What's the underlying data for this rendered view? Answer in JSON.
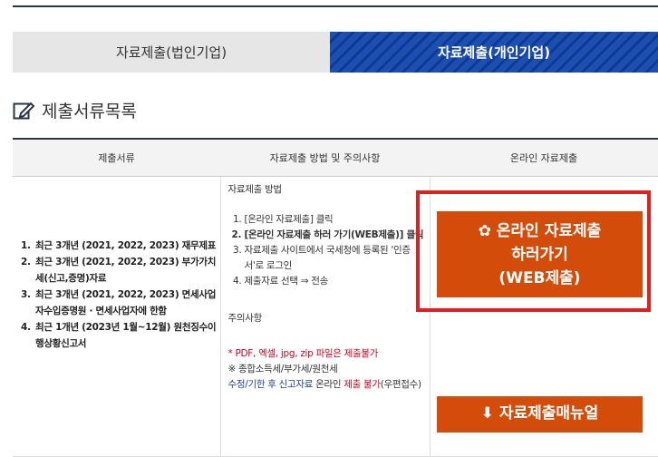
{
  "tabs": {
    "corporate": "자료제출(법인기업)",
    "individual": "자료제출(개인기업)"
  },
  "section": {
    "title": "제출서류목록"
  },
  "table": {
    "headers": [
      "제출서류",
      "자료제출 방법 및 주의사항",
      "온라인 자료제출"
    ],
    "documents": [
      "최근 3개년 (2021, 2022, 2023) 재무제표",
      "최근 3개년 (2021, 2022, 2023) 부가가치세(신고,증명)자료",
      "최근 3개년 (2021, 2022, 2023) 면세사업자수입증명원 · 면세사업자에 한함",
      "최근 1개년 (2023년 1월~12월) 원천징수이행상황신고서"
    ],
    "method": {
      "heading": "자료제출 방법",
      "steps": [
        "[온라인 자료제출] 클릭",
        "[온라인 자료제출 하러 가기(WEB제출)] 클릭",
        "자료제출 사이트에서 국세청에 등록된 '인증서'로 로그인",
        "제출자료 선택 ⇒ 전송"
      ],
      "notes_heading": "주의사항",
      "note1": "* PDF, 엑셀, jpg, zip 파일은 제출불가",
      "note2": "※ 종합소득세/부가세/원천세",
      "note3_a": "수정/기한 후 신고자료",
      "note3_b": " 온라인 ",
      "note3_c": "제출 불가",
      "note3_d": "(우편접수)"
    },
    "online": {
      "web_button_line1": "온라인 자료제출",
      "web_button_line2": "하러가기",
      "web_button_line3": "(WEB제출)",
      "manual_button": "자료제출매뉴얼"
    }
  },
  "colors": {
    "accent": "#d34c0a",
    "highlight": "#e0201f",
    "tab_active": "#1d4fb0"
  }
}
